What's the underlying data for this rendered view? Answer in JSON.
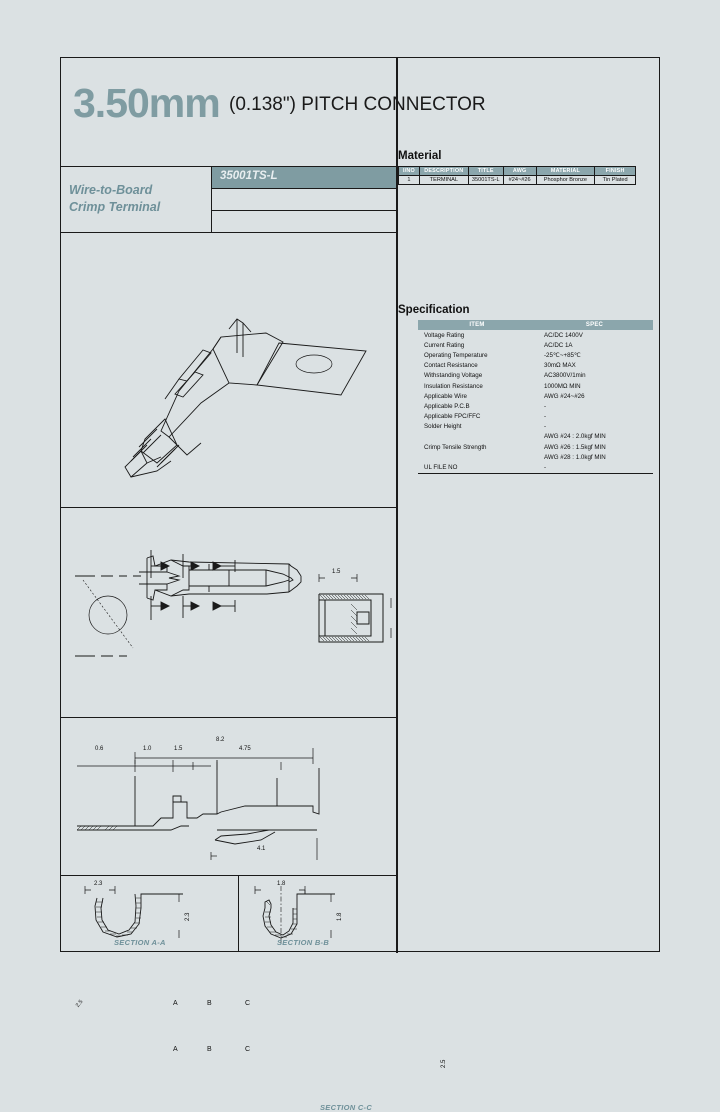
{
  "page": {
    "background_color": "#dbe1e3",
    "accent_color": "#7f9ca2",
    "line_color": "#1a1a1a"
  },
  "header": {
    "title_main": "3.50mm",
    "title_sub": "(0.138\") PITCH CONNECTOR"
  },
  "title_block": {
    "product_name_line1": "Wire-to-Board",
    "product_name_line2": "Crimp Terminal",
    "part_number": "35001TS-L"
  },
  "material": {
    "heading": "Material",
    "columns": [
      "I/NO",
      "DESCRIPTION",
      "TITLE",
      "AWG",
      "MATERIAL",
      "FINISH"
    ],
    "rows": [
      [
        "1",
        "TERMINAL",
        "35001TS-L",
        "#24~#26",
        "Phosphor Bronze",
        "Tin Plated"
      ]
    ]
  },
  "specification": {
    "heading": "Specification",
    "columns": [
      "ITEM",
      "SPEC"
    ],
    "rows": [
      {
        "item": "Voltage Rating",
        "spec": "AC/DC 1400V"
      },
      {
        "item": "Current Rating",
        "spec": "AC/DC 1A"
      },
      {
        "item": "Operating Temperature",
        "spec": "-25℃~+85℃"
      },
      {
        "item": "Contact Resistance",
        "spec": "30mΩ MAX"
      },
      {
        "item": "Withstanding Voltage",
        "spec": "AC3800V/1min"
      },
      {
        "item": "Insulation Resistance",
        "spec": "1000MΩ MIN"
      },
      {
        "item": "Applicable Wire",
        "spec": "AWG #24~#26"
      },
      {
        "item": "Applicable P.C.B",
        "spec": "-"
      },
      {
        "item": "Applicable FPC/FFC",
        "spec": "-"
      },
      {
        "item": "Solder Height",
        "spec": "-"
      },
      {
        "item": "Crimp Tensile Strength",
        "spec": "AWG #24 : 2.0kgf MIN\nAWG #26 : 1.5kgf MIN\nAWG #28 : 1.0kgf MIN"
      },
      {
        "item": "UL FILE NO",
        "spec": "-"
      }
    ],
    "crimp_tensile": [
      "AWG #24 : 2.0kgf MIN",
      "AWG #26 : 1.5kgf MIN",
      "AWG #28 : 1.0kgf MIN"
    ]
  },
  "drawings": {
    "plan_view": {
      "section_marks": [
        "A",
        "B",
        "C",
        "A",
        "B",
        "C"
      ],
      "leader_note": "2.5"
    },
    "section_cc": {
      "label": "SECTION C-C",
      "dim_width": "1.5",
      "dim_height": "2.5"
    },
    "side_view": {
      "dim_overall": "8.2",
      "dim_1": "0.6",
      "dim_2": "1.0",
      "dim_3": "1.5",
      "dim_4": "4.75",
      "dim_5": "4.1"
    },
    "section_aa": {
      "label": "SECTION A-A",
      "dim_width": "2.3",
      "dim_height": "2.3"
    },
    "section_bb": {
      "label": "SECTION B-B",
      "dim_width": "1.8",
      "dim_height": "1.8"
    }
  }
}
